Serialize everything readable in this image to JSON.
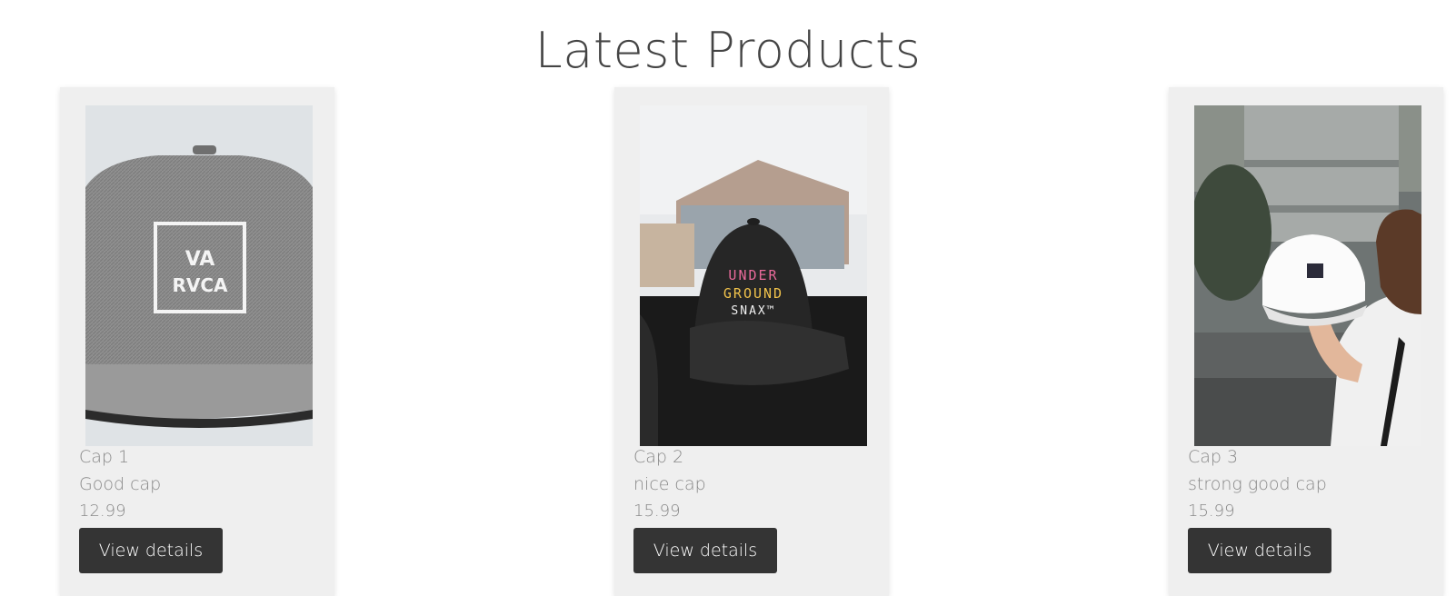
{
  "page": {
    "title": "Latest Products"
  },
  "products": [
    {
      "name": "Cap 1",
      "description": "Good cap",
      "price": "12.99",
      "button_label": "View details",
      "image_logo_text": [
        "VA",
        "RVCA"
      ]
    },
    {
      "name": "Cap 2",
      "description": "nice cap",
      "price": "15.99",
      "button_label": "View details",
      "image_logo_text": [
        "UNDER",
        "GROUND",
        "SNAX™"
      ]
    },
    {
      "name": "Cap 3",
      "description": "strong good cap",
      "price": "15.99",
      "button_label": "View details",
      "image_logo_text": []
    }
  ],
  "colors": {
    "button_bg": "#343434",
    "card_bg": "#efefef",
    "title_text": "#444444",
    "meta_text": "#888888"
  }
}
